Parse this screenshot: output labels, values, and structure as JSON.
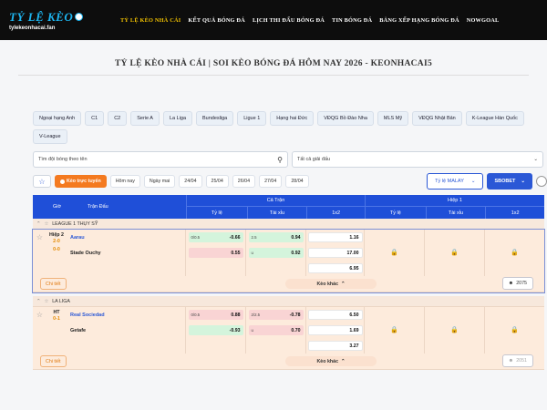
{
  "brand": {
    "name": "TỶ LỆ KÈO",
    "url": "tylekeonhacai.fan"
  },
  "nav": [
    "TỶ LỆ KÈO NHÀ CÁI",
    "KẾT QUẢ BÓNG ĐÁ",
    "LỊCH THI ĐẤU BÓNG ĐÁ",
    "TIN BÓNG ĐÁ",
    "BẢNG XẾP HẠNG BÓNG ĐÁ",
    "NOWGOAL"
  ],
  "page_title": "TỶ LỆ KÈO NHÀ CÁI | SOI KÈO BÓNG ĐÁ HÔM NAY 2026 - KEONHACAI5",
  "leagues": [
    "Ngoại hạng Anh",
    "C1",
    "C2",
    "Serie A",
    "La Liga",
    "Bundesliga",
    "Ligue 1",
    "Hạng hai Đức",
    "VĐQG Bồ Đào Nha",
    "MLS Mỹ",
    "VĐQG Nhật Bản",
    "K-League Hàn Quốc",
    "V-League"
  ],
  "search": {
    "placeholder": "Tìm đội bóng theo tên"
  },
  "league_select": {
    "value": "Tất cả giải đấu"
  },
  "filters": {
    "live": "Kèo trực tuyến",
    "today": "Hôm nay",
    "tomorrow": "Ngày mai",
    "dates": [
      "24/04",
      "25/04",
      "26/04",
      "27/04",
      "28/04"
    ]
  },
  "odds_type": "Tỷ lệ MALAY",
  "bookmaker": "SBOBET",
  "header": {
    "match_col": "Trận Đấu",
    "time_col": "Giờ",
    "full_time": "Cả Trận",
    "half_time": "Hiệp 1",
    "cols": [
      "Tỷ lệ",
      "Tài xỉu",
      "1x2"
    ],
    "cols_h1": [
      "Tỷ lệ",
      "Tài xỉu",
      "1x2"
    ]
  },
  "groups": [
    {
      "league": "LEAGUE 1 THỤY SỸ",
      "match": {
        "status": "Hiệp 2",
        "score_home": "2-0",
        "score_away": "0-0",
        "home": "Aarau",
        "away": "Stade Ouchy",
        "handicap": [
          {
            "line": "0/0.5",
            "val": "-0.66",
            "color": "green"
          },
          {
            "line": "",
            "val": "0.55",
            "color": "red"
          }
        ],
        "ou": [
          {
            "line": "2.5",
            "val": "0.94",
            "color": "green"
          },
          {
            "line": "u",
            "val": "0.92",
            "color": "green"
          }
        ],
        "x12": [
          "1.16",
          "17.00",
          "6.95"
        ],
        "detail": "Chi tiết",
        "more": "Kèo khác",
        "views": "2075"
      }
    },
    {
      "league": "LA LIGA",
      "match": {
        "status": "HT",
        "score_home": "0-1",
        "score_away": "",
        "home": "Real Sociedad",
        "away": "Getafe",
        "handicap": [
          {
            "line": "0/0.5",
            "val": "0.88",
            "color": "red"
          },
          {
            "line": "",
            "val": "-0.93",
            "color": "green"
          }
        ],
        "ou": [
          {
            "line": "2/2.5",
            "val": "-0.78",
            "color": "red"
          },
          {
            "line": "u",
            "val": "0.70",
            "color": "red"
          }
        ],
        "x12": [
          "6.50",
          "1.69",
          "3.27"
        ],
        "detail": "Chi tiết",
        "more": "Kèo khác",
        "views": "2051"
      }
    }
  ]
}
